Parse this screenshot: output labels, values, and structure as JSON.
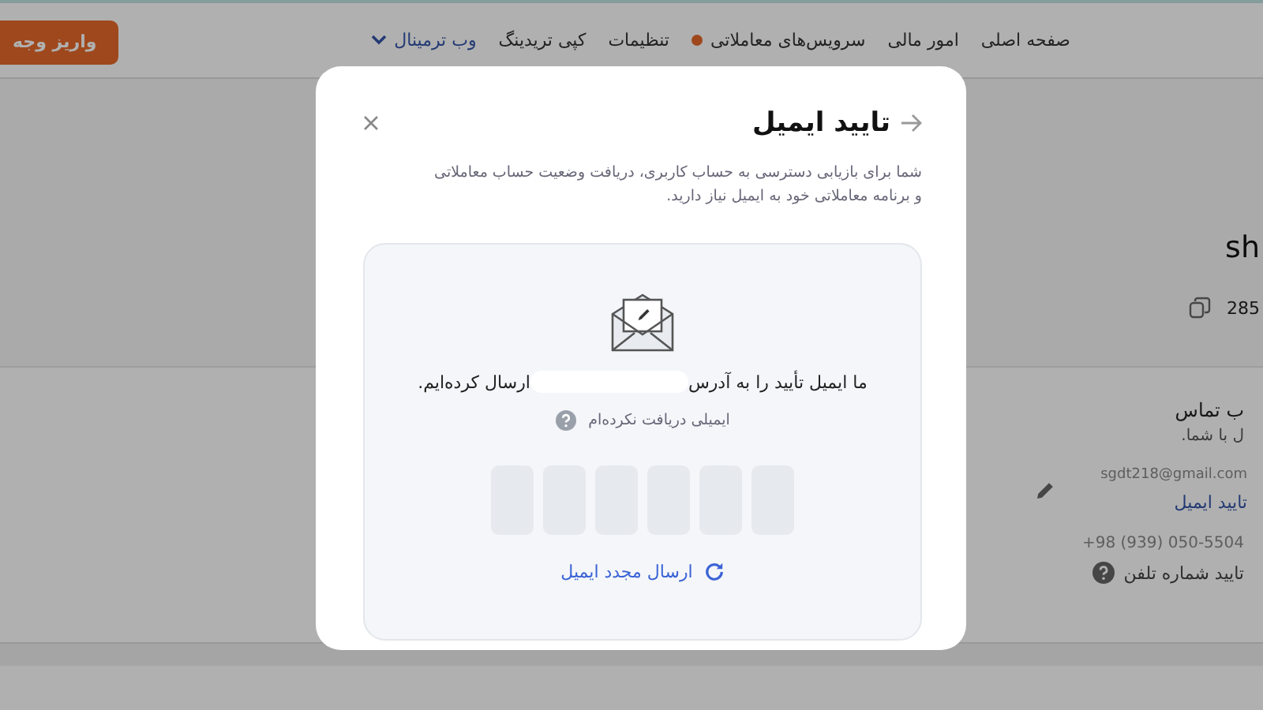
{
  "header": {
    "nav": [
      {
        "label": "صفحه اصلی",
        "kind": "link",
        "has_dot": false
      },
      {
        "label": "امور مالی",
        "kind": "link",
        "has_dot": false
      },
      {
        "label": "سرویس‌های معاملاتی",
        "kind": "link",
        "has_dot": true
      },
      {
        "label": "تنظیمات",
        "kind": "link",
        "has_dot": false
      },
      {
        "label": "کپی تریدینگ",
        "kind": "link",
        "has_dot": false
      },
      {
        "label": "وب ترمینال",
        "kind": "dropdown",
        "has_dot": false
      }
    ],
    "deposit_button": "واریز وجه"
  },
  "profile": {
    "name": "sh",
    "account_number": "285",
    "contact_title": "ب تماس",
    "contact_subtitle": "ل با شما.",
    "email": "sgdt218@gmail.com",
    "email_action": "تایید ایمیل",
    "phone": "+98 (939) 050-5504",
    "phone_action": "تایید شماره تلفن"
  },
  "modal": {
    "title": "تایید ایمیل",
    "description": "شما برای بازیابی دسترسی به حساب کاربری، دریافت وضعیت حساب معاملاتی و برنامه معاملاتی خود به ایمیل نیاز دارید.",
    "sent_before": "ما ایمیل تأیید را به آدرس",
    "sent_after": "ارسال کرده‌ایم.",
    "help": "ایمیلی دریافت نکرده‌ام",
    "code_fields": [
      {
        "filled": false
      },
      {
        "filled": false
      },
      {
        "filled": false
      },
      {
        "filled": false
      },
      {
        "filled": false
      },
      {
        "filled": false
      }
    ],
    "resend": "ارسال مجدد ایمیل"
  }
}
